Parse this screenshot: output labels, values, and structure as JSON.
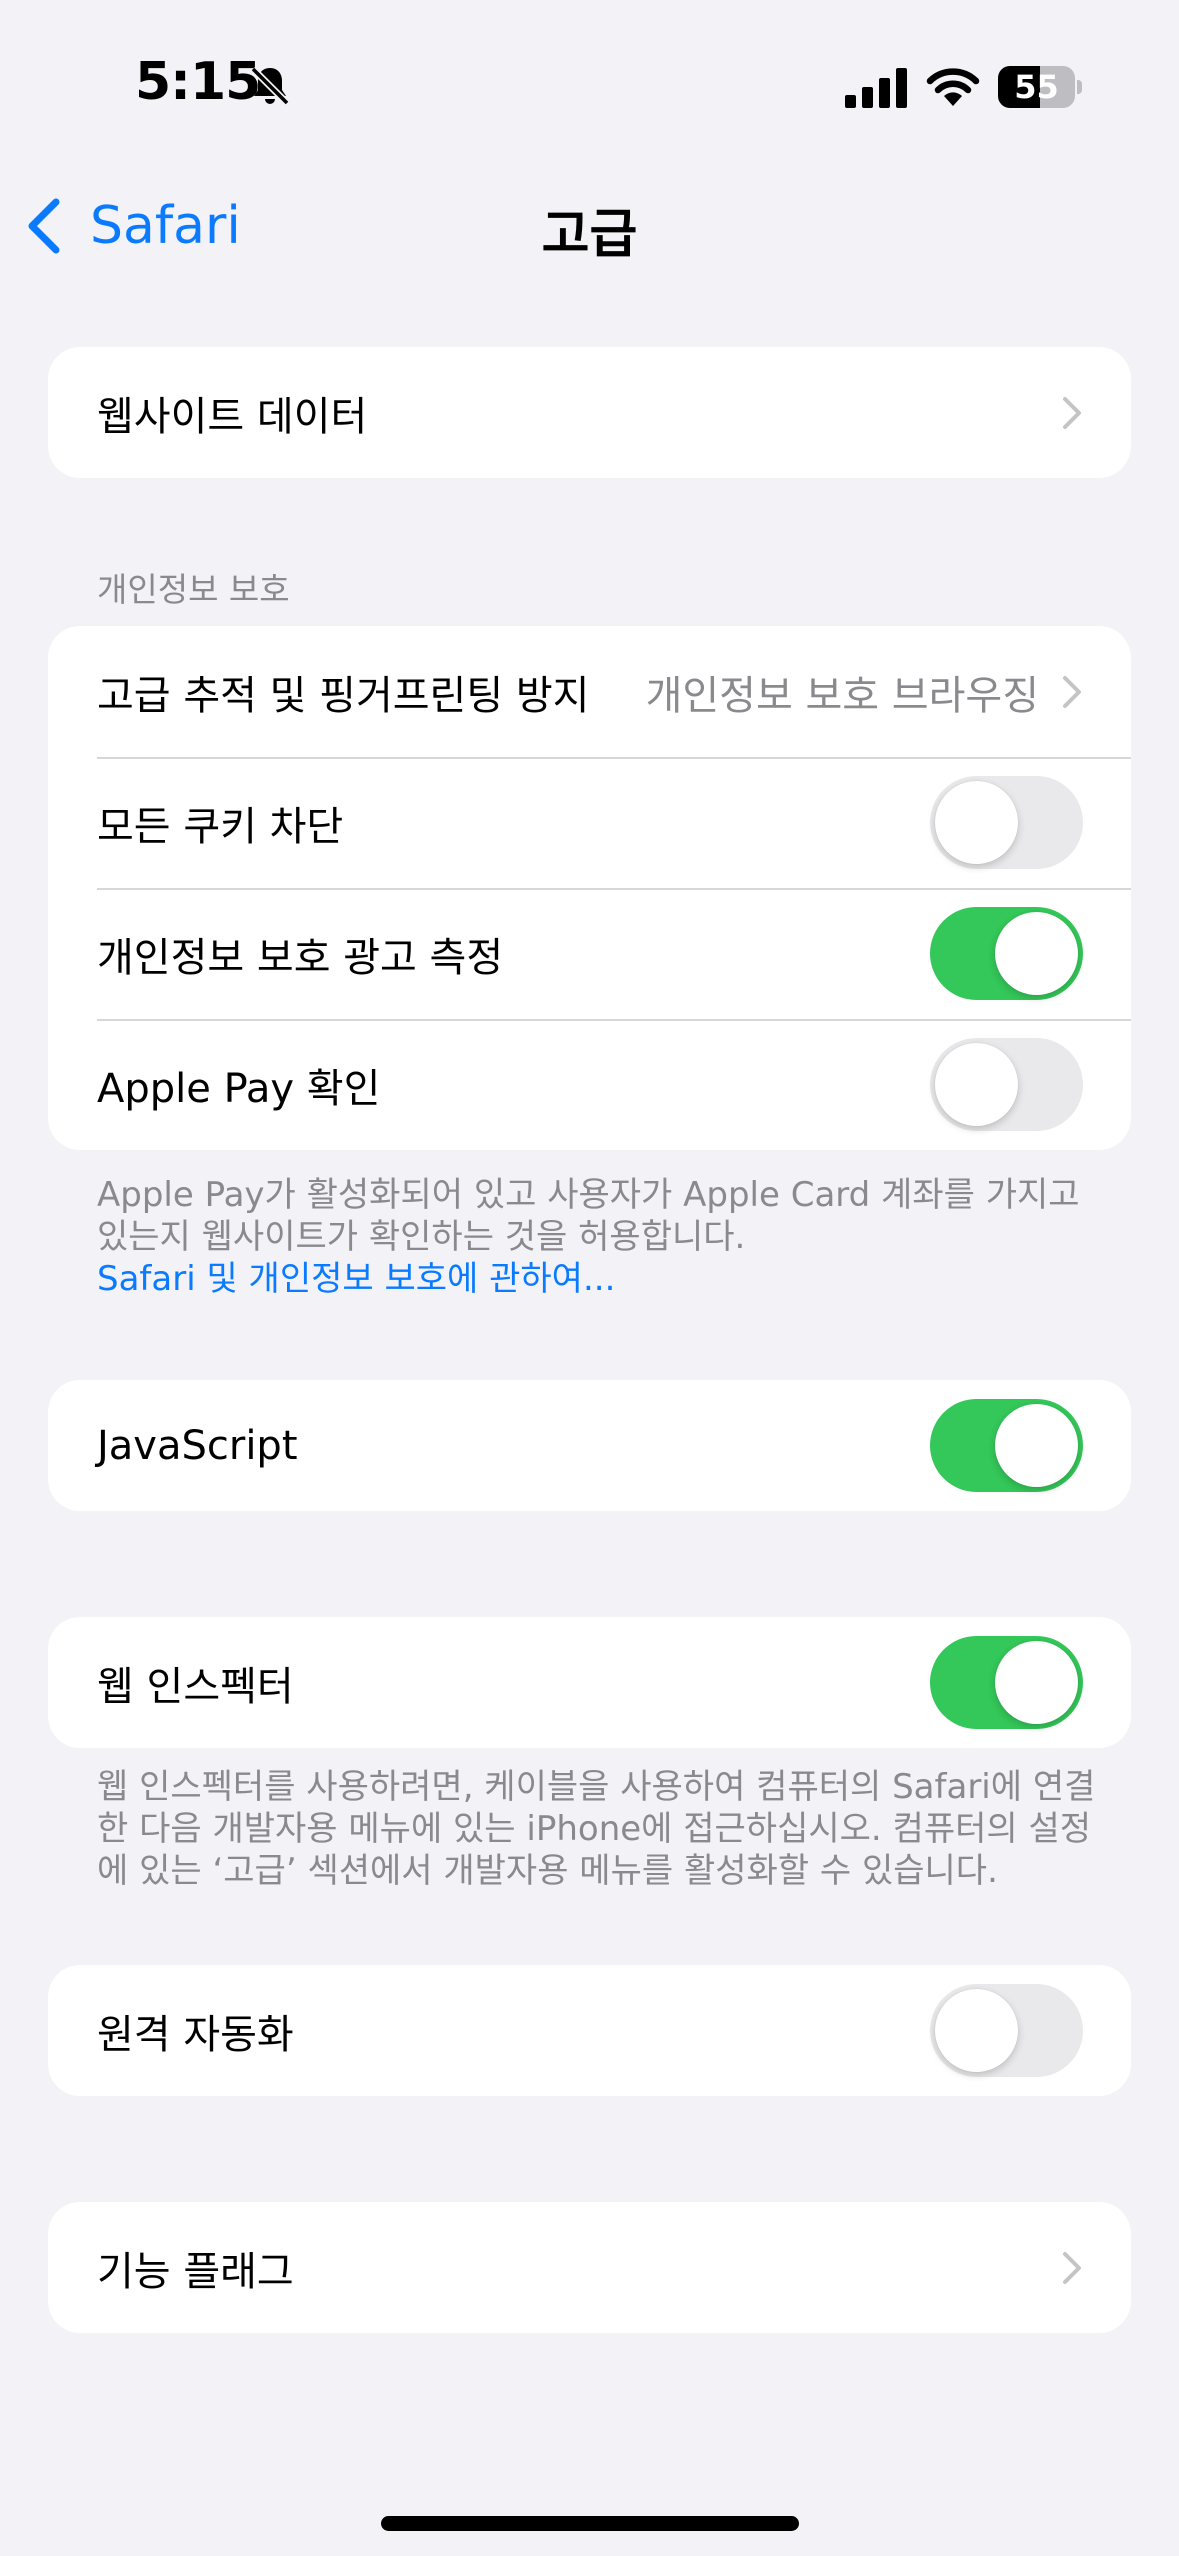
{
  "status_bar": {
    "time": "5:15",
    "battery": "55",
    "battery_level": 0.55
  },
  "nav": {
    "back_label": "Safari",
    "title": "고급"
  },
  "website_data": {
    "label": "웹사이트 데이터"
  },
  "privacy": {
    "header": "개인정보 보호",
    "tracking_label": "고급 추적 및 핑거프린팅 방지",
    "tracking_value": "개인정보 보호 브라우징",
    "block_cookies_label": "모든 쿠키 차단",
    "block_cookies_on": false,
    "ad_measurement_label": "개인정보 보호 광고 측정",
    "ad_measurement_on": true,
    "apple_pay_label": "Apple Pay 확인",
    "apple_pay_on": false,
    "footer": "Apple Pay가 활성화되어 있고 사용자가 Apple Card 계좌를 가지고 있는지 웹사이트가 확인하는 것을 허용합니다.",
    "footer_link": "Safari 및 개인정보 보호에 관하여..."
  },
  "javascript": {
    "label": "JavaScript",
    "on": true
  },
  "web_inspector": {
    "label": "웹 인스펙터",
    "on": true,
    "footer": "웹 인스펙터를 사용하려면, 케이블을 사용하여 컴퓨터의 Safari에 연결한 다음 개발자용 메뉴에 있는 iPhone에 접근하십시오. 컴퓨터의 설정에 있는 ‘고급’ 섹션에서 개발자용 메뉴를 활성화할 수 있습니다."
  },
  "remote_automation": {
    "label": "원격 자동화",
    "on": false
  },
  "feature_flags": {
    "label": "기능 플래그"
  },
  "colors": {
    "accent": "#0A7AFF",
    "toggle_on": "#34C759",
    "toggle_off": "#E9E9EB",
    "background": "#F2F2F7"
  },
  "icons": [
    "bell-slash-icon",
    "cellular-signal-icon",
    "wifi-icon",
    "battery-icon",
    "chevron-left-icon",
    "chevron-right-icon"
  ]
}
